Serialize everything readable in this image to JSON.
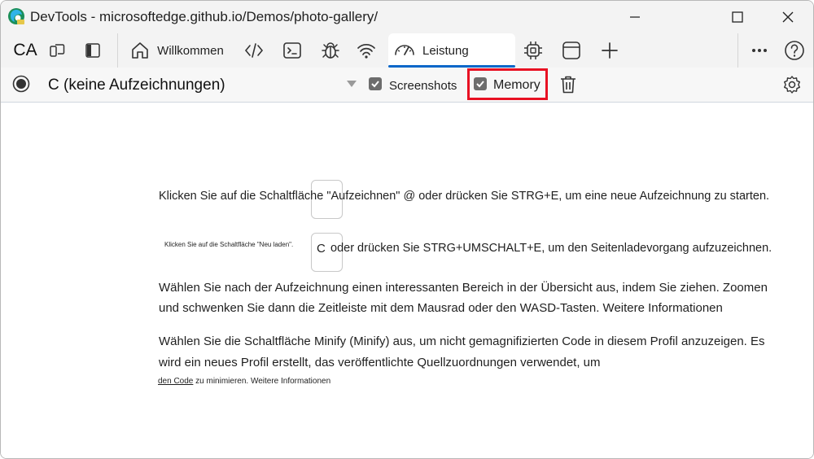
{
  "window": {
    "title": "DevTools - microsoftedge.github.io/Demos/photo-gallery/"
  },
  "tabbar": {
    "device_label": "CA",
    "tabs": [
      {
        "label": "Willkommen",
        "icon": "home-icon"
      },
      {
        "label": "",
        "icon": "code-icon"
      },
      {
        "label": "",
        "icon": "console-icon"
      },
      {
        "label": "",
        "icon": "bug-icon"
      },
      {
        "label": "",
        "icon": "wifi-icon"
      },
      {
        "label": "Leistung",
        "icon": "performance-gauge-icon",
        "active": true
      },
      {
        "label": "",
        "icon": "cpu-icon"
      },
      {
        "label": "",
        "icon": "application-icon"
      }
    ]
  },
  "toolbar": {
    "session_label": "C (keine Aufzeichnungen)",
    "screenshots_label": "Screenshots",
    "screenshots_checked": true,
    "memory_label": "Memory",
    "memory_checked": true
  },
  "content": {
    "line1": "Klicken Sie auf die Schaltfläche \"Aufzeichnen\" @ oder drücken Sie STRG+E, um eine neue Aufzeichnung zu starten.",
    "reload_small": "Klicken Sie auf die Schaltfläche \"Neu laden\".",
    "reload_key": "C",
    "line2": "oder drücken Sie STRG+UMSCHALT+E, um den Seitenladevorgang aufzuzeichnen.",
    "para3_line1": "Wählen Sie nach der Aufzeichnung einen interessanten Bereich in der Übersicht aus, indem Sie ziehen. Zoomen",
    "para3_line2": "und schwenken Sie dann die Zeitleiste mit dem Mausrad oder den WASD-Tasten. Weitere Informationen",
    "para4_line1": "Wählen Sie die Schaltfläche Minify (Minify) aus, um nicht gemagnifizierten Code in diesem Profil anzuzeigen. Es",
    "para4_line2": "wird ein neues Profil erstellt, das veröffentlichte Quellzuordnungen verwendet, um",
    "para4_small_link": "den Code",
    "para4_small_rest": " zu minimieren. Weitere Informationen"
  },
  "colors": {
    "accent": "#0a67c9",
    "highlight": "#e81123"
  }
}
